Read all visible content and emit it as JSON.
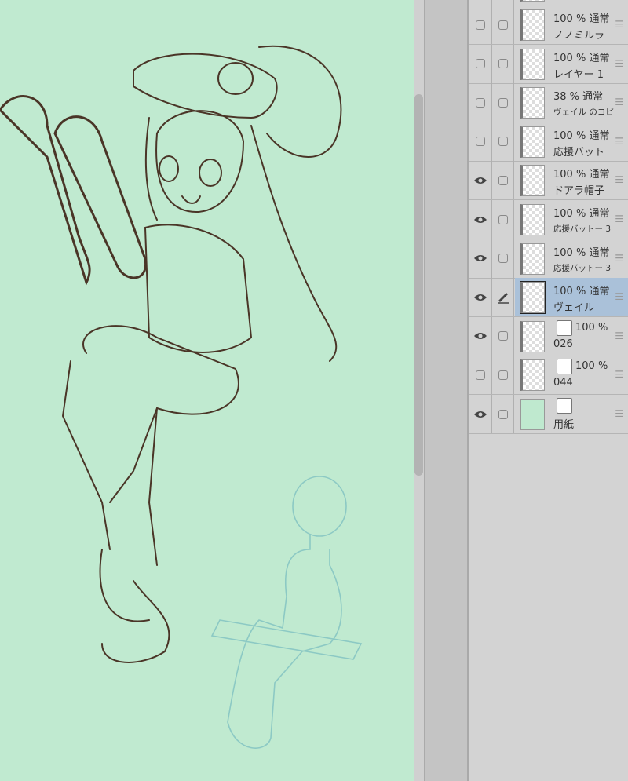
{
  "canvas": {
    "background": "#c0ead0",
    "line_color": "#4a3527",
    "mannequin_color": "#8cc9c4"
  },
  "layers": [
    {
      "opacity": "100 %",
      "blend": "通常",
      "name": "ノノミルラ",
      "visible": false,
      "type": "raster"
    },
    {
      "opacity": "100 %",
      "blend": "通常",
      "name": "レイヤー 1",
      "visible": false,
      "type": "raster"
    },
    {
      "opacity": "38 %",
      "blend": "通常",
      "name": "ヴェイル のコピ",
      "visible": false,
      "type": "raster",
      "small": true
    },
    {
      "opacity": "100 %",
      "blend": "通常",
      "name": "応援バット",
      "visible": false,
      "type": "raster"
    },
    {
      "opacity": "100 %",
      "blend": "通常",
      "name": "ドアラ帽子",
      "visible": true,
      "type": "raster"
    },
    {
      "opacity": "100 %",
      "blend": "通常",
      "name": "応援バットー 3",
      "visible": true,
      "type": "raster",
      "small": true
    },
    {
      "opacity": "100 %",
      "blend": "通常",
      "name": "応援バットー 3",
      "visible": true,
      "type": "raster",
      "small": true
    },
    {
      "opacity": "100 %",
      "blend": "通常",
      "name": "ヴェイル",
      "visible": true,
      "type": "raster",
      "selected": true
    },
    {
      "opacity": "100 %",
      "name": "026",
      "visible": true,
      "type": "3d"
    },
    {
      "opacity": "100 %",
      "name": "044",
      "visible": false,
      "type": "3d"
    },
    {
      "name": "用紙",
      "visible": true,
      "type": "paper"
    }
  ],
  "selected_color": "#aac1d9"
}
